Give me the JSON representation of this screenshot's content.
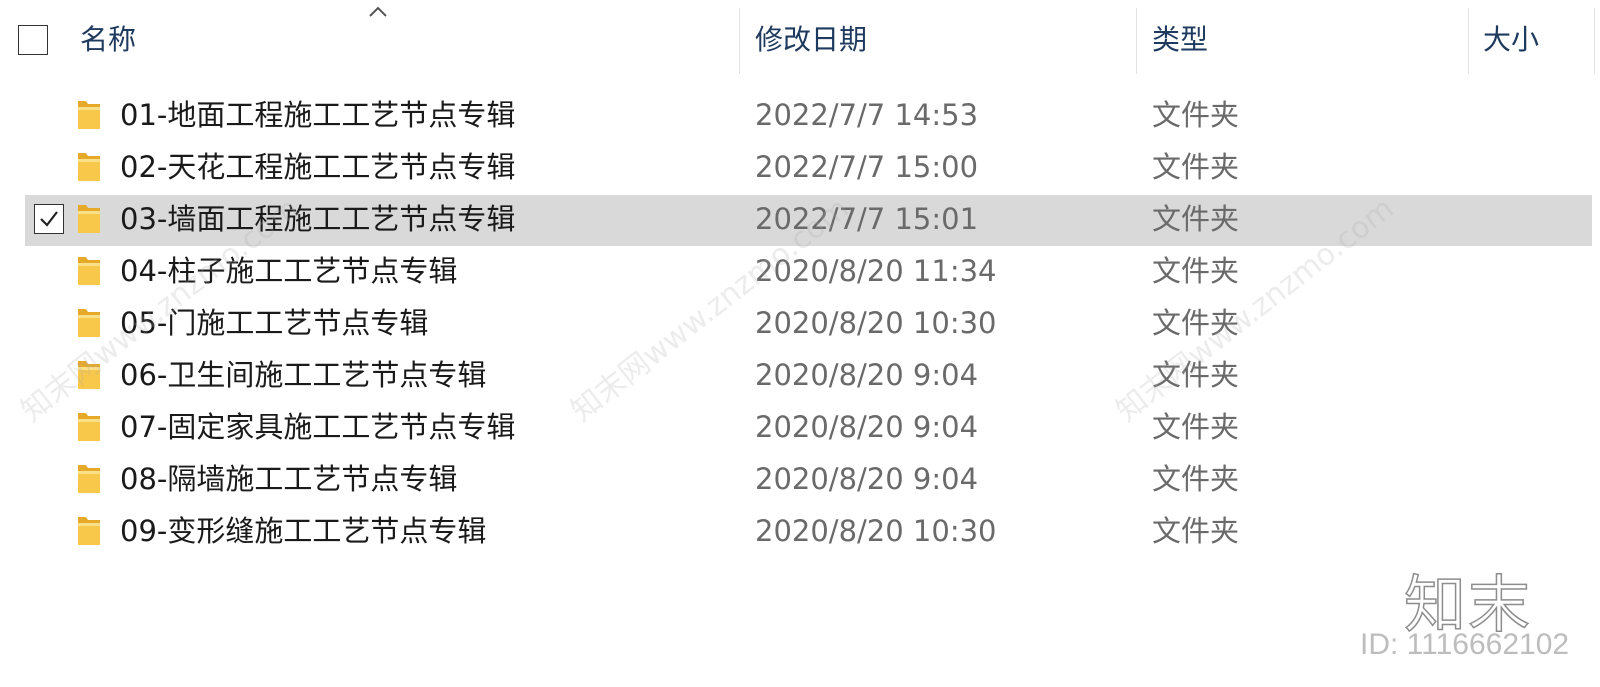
{
  "header": {
    "col_name": "名称",
    "col_date": "修改日期",
    "col_type": "类型",
    "col_size": "大小"
  },
  "files": [
    {
      "name": "01-地面工程施工工艺节点专辑",
      "date": "2022/7/7 14:53",
      "type": "文件夹",
      "selected": false
    },
    {
      "name": "02-天花工程施工工艺节点专辑",
      "date": "2022/7/7 15:00",
      "type": "文件夹",
      "selected": false
    },
    {
      "name": "03-墙面工程施工工艺节点专辑",
      "date": "2022/7/7 15:01",
      "type": "文件夹",
      "selected": true
    },
    {
      "name": "04-柱子施工工艺节点专辑",
      "date": "2020/8/20 11:34",
      "type": "文件夹",
      "selected": false
    },
    {
      "name": "05-门施工工艺节点专辑",
      "date": "2020/8/20 10:30",
      "type": "文件夹",
      "selected": false
    },
    {
      "name": "06-卫生间施工工艺节点专辑",
      "date": "2020/8/20 9:04",
      "type": "文件夹",
      "selected": false
    },
    {
      "name": "07-固定家具施工工艺节点专辑",
      "date": "2020/8/20 9:04",
      "type": "文件夹",
      "selected": false
    },
    {
      "name": "08-隔墙施工工艺节点专辑",
      "date": "2020/8/20 9:04",
      "type": "文件夹",
      "selected": false
    },
    {
      "name": "09-变形缝施工工艺节点专辑",
      "date": "2020/8/20 10:30",
      "type": "文件夹",
      "selected": false
    }
  ],
  "watermark": {
    "brand": "知末",
    "id_text": "ID: 1116662102",
    "diagonal_text": "知末网www.znzmo.com"
  },
  "colors": {
    "header_text": "#1e3a5f",
    "selected_row": "#d9d9d9",
    "folder_yellow": "#f8c84a"
  },
  "icons": {
    "sort": "chevron-up-icon",
    "folder": "folder-icon",
    "check": "checkmark-icon"
  }
}
